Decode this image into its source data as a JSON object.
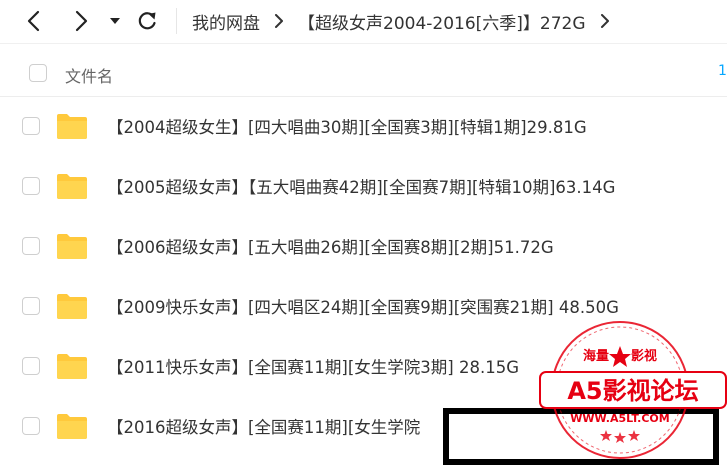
{
  "toolbar": {
    "back_icon": "chevron-left-icon",
    "forward_icon": "chevron-right-icon",
    "history_icon": "caret-down-icon",
    "refresh_icon": "refresh-icon"
  },
  "breadcrumb": {
    "items": [
      "我的网盘",
      "【超级女声2004-2016[六季]】272G"
    ]
  },
  "header": {
    "column_name": "文件名",
    "right_fragment": "1"
  },
  "files": [
    {
      "name": "【2004超级女生】[四大唱曲30期][全国赛3期][特辑1期]29.81G",
      "type": "folder"
    },
    {
      "name": "【2005超级女声】【五大唱曲赛42期][全国赛7期][特辑10期]63.14G",
      "type": "folder"
    },
    {
      "name": "【2006超级女声】[五大唱曲26期][全国赛8期][2期]51.72G",
      "type": "folder"
    },
    {
      "name": "【2009快乐女声】[四大唱区24期][全国赛9期][突围赛21期] 48.50G",
      "type": "folder"
    },
    {
      "name": "【2011快乐女声】[全国赛11期][女生学院3期] 28.15G",
      "type": "folder"
    },
    {
      "name": "【2016超级女声】[全国赛11期][女生学院",
      "type": "folder"
    }
  ],
  "watermark": {
    "top_text": "海量",
    "top_text_right": "影视",
    "main": "A5影视论坛",
    "url": "WWW.A5LT.COM"
  },
  "colors": {
    "folder": "#ffc93c",
    "accent": "#06a7ff",
    "stamp_red": "#e60012"
  }
}
